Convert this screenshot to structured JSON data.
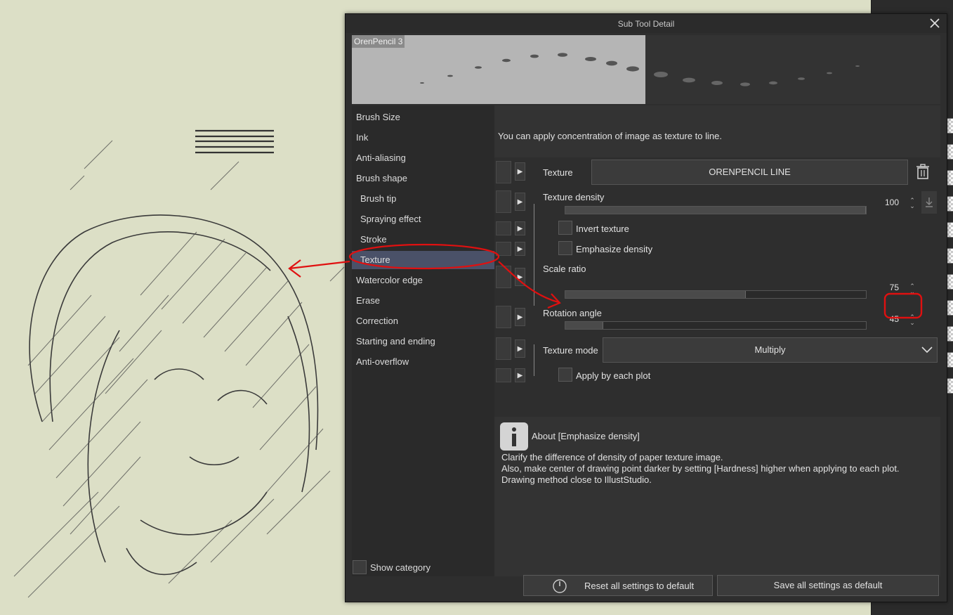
{
  "dialog": {
    "title": "Sub Tool Detail",
    "brush_name": "OrenPencil 3"
  },
  "categories": [
    {
      "label": "Brush Size",
      "sub": false
    },
    {
      "label": "Ink",
      "sub": false
    },
    {
      "label": "Anti-aliasing",
      "sub": false
    },
    {
      "label": "Brush shape",
      "sub": false
    },
    {
      "label": "Brush tip",
      "sub": true
    },
    {
      "label": "Spraying effect",
      "sub": true
    },
    {
      "label": "Stroke",
      "sub": true
    },
    {
      "label": "Texture",
      "sub": true,
      "selected": true
    },
    {
      "label": "Watercolor edge",
      "sub": false
    },
    {
      "label": "Erase",
      "sub": false
    },
    {
      "label": "Correction",
      "sub": false
    },
    {
      "label": "Starting and ending",
      "sub": false
    },
    {
      "label": "Anti-overflow",
      "sub": false
    }
  ],
  "show_category_label": "Show category",
  "description": "You can apply concentration of image as texture to line.",
  "settings": {
    "texture_label": "Texture",
    "texture_value": "ORENPENCIL LINE",
    "texture_density_label": "Texture density",
    "texture_density_value": "100",
    "texture_density_fraction": 1.0,
    "invert_texture_label": "Invert texture",
    "emphasize_density_label": "Emphasize density",
    "scale_ratio_label": "Scale ratio",
    "scale_ratio_value": "75",
    "scale_ratio_fraction": 0.6,
    "rotation_angle_label": "Rotation angle",
    "rotation_angle_value": "45",
    "rotation_angle_fraction": 0.125,
    "texture_mode_label": "Texture mode",
    "texture_mode_value": "Multiply",
    "apply_each_plot_label": "Apply by each plot"
  },
  "info": {
    "title": "About [Emphasize density]",
    "lines": [
      "Clarify the difference of density of paper texture image.",
      "Also, make center of drawing point darker by setting [Hardness] higher when applying to each plot.",
      "Drawing method close to IllustStudio."
    ]
  },
  "footer": {
    "reset_label": "Reset all settings to default",
    "save_label": "Save all settings as default"
  },
  "colors": {
    "canvas": "#dcdfc6",
    "dialog_bg": "#2e2e2e",
    "selected_item": "#4a5168",
    "annotation_red": "#e01010"
  }
}
